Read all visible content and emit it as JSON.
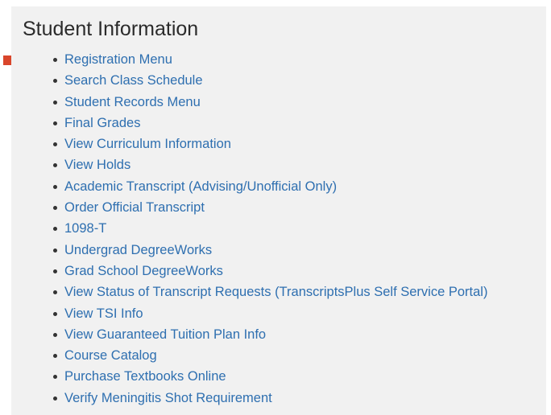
{
  "section": {
    "title": "Student Information"
  },
  "arrow": {
    "color": "#d9462b"
  },
  "menu": {
    "link_color": "#2e6fb0",
    "items": [
      {
        "label": "Registration Menu"
      },
      {
        "label": "Search Class Schedule"
      },
      {
        "label": "Student Records Menu"
      },
      {
        "label": "Final Grades"
      },
      {
        "label": "View Curriculum Information"
      },
      {
        "label": "View Holds"
      },
      {
        "label": "Academic Transcript (Advising/Unofficial Only)"
      },
      {
        "label": "Order Official Transcript"
      },
      {
        "label": "1098-T"
      },
      {
        "label": "Undergrad DegreeWorks"
      },
      {
        "label": "Grad School DegreeWorks"
      },
      {
        "label": "View Status of Transcript Requests (TranscriptsPlus Self Service Portal)"
      },
      {
        "label": "View TSI Info"
      },
      {
        "label": "View Guaranteed Tuition Plan Info"
      },
      {
        "label": "Course Catalog"
      },
      {
        "label": "Purchase Textbooks Online"
      },
      {
        "label": "Verify Meningitis Shot Requirement"
      }
    ]
  }
}
